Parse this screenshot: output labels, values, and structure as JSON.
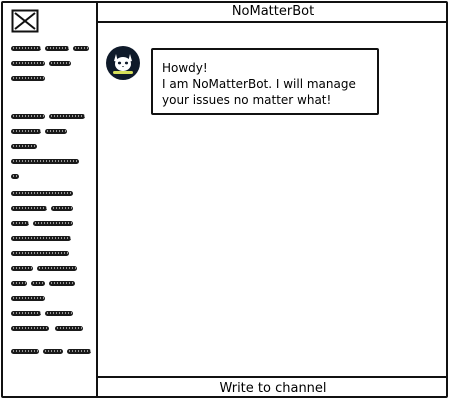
{
  "header": {
    "title": "NoMatterBot"
  },
  "chat": {
    "messages": [
      {
        "author": "bot",
        "avatar_icon": "cat-icon",
        "lines": [
          "Howdy!",
          "I am NoMatterBot. I will manage",
          "your issues no matter what!"
        ]
      }
    ]
  },
  "composer": {
    "placeholder": "Write to channel"
  },
  "sidebar": {
    "logo_icon": "window-close-icon"
  }
}
